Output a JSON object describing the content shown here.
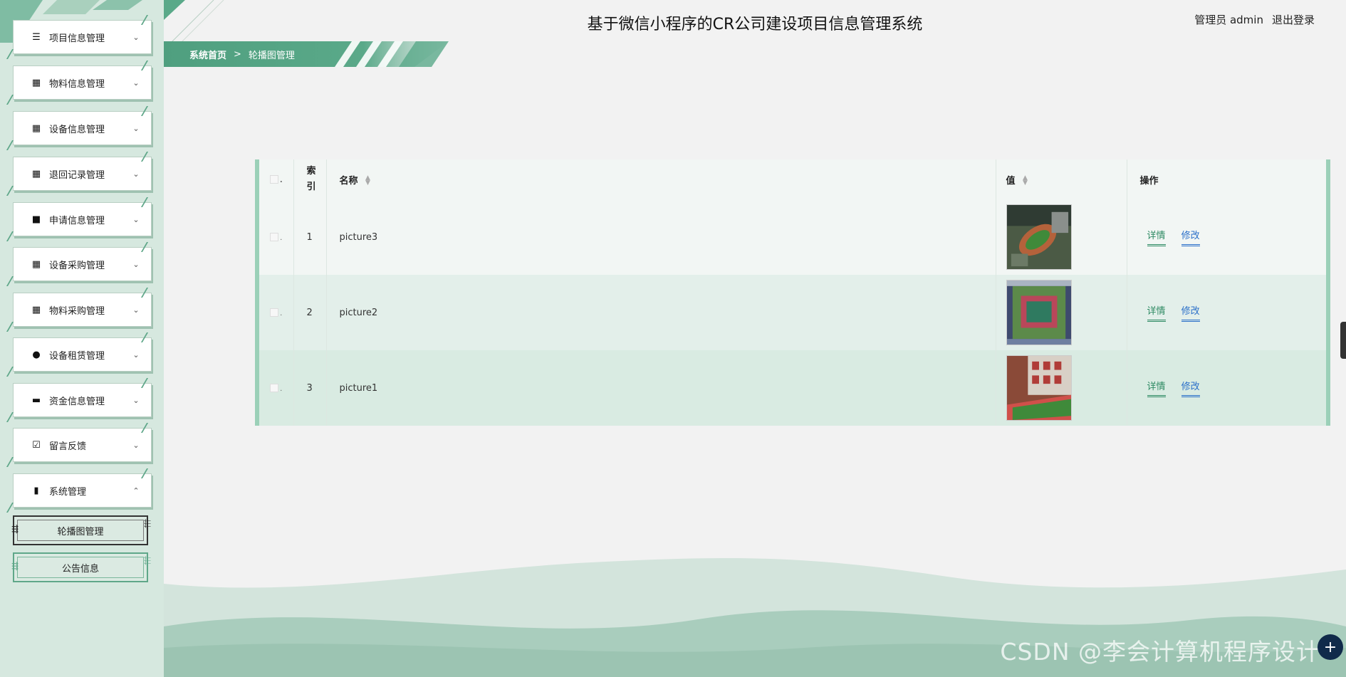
{
  "header": {
    "title": "基于微信小程序的CR公司建设项目信息管理系统",
    "user_label": "管理员 admin",
    "logout_label": "退出登录"
  },
  "breadcrumb": {
    "home": "系统首页",
    "separator": ">",
    "current": "轮播图管理"
  },
  "sidebar": {
    "items": [
      {
        "label": "项目信息管理",
        "icon": "list-icon"
      },
      {
        "label": "物料信息管理",
        "icon": "grid-icon"
      },
      {
        "label": "设备信息管理",
        "icon": "grid-icon"
      },
      {
        "label": "退回记录管理",
        "icon": "grid-icon"
      },
      {
        "label": "申请信息管理",
        "icon": "briefcase-icon"
      },
      {
        "label": "设备采购管理",
        "icon": "grid-icon"
      },
      {
        "label": "物料采购管理",
        "icon": "grid-icon"
      },
      {
        "label": "设备租赁管理",
        "icon": "pin-icon"
      },
      {
        "label": "资金信息管理",
        "icon": "ticket-icon"
      },
      {
        "label": "留言反馈",
        "icon": "clipboard-icon"
      },
      {
        "label": "系统管理",
        "icon": "book-icon"
      }
    ],
    "sub_items": [
      "轮播图管理",
      "公告信息"
    ]
  },
  "table": {
    "columns": {
      "index": "索引",
      "name": "名称",
      "value": "值",
      "ops": "操作"
    },
    "rows": [
      {
        "index": "1",
        "name": "picture3"
      },
      {
        "index": "2",
        "name": "picture2"
      },
      {
        "index": "3",
        "name": "picture1"
      }
    ],
    "detail_label": "详情",
    "edit_label": "修改"
  },
  "watermark": "CSDN @李会计算机程序设计",
  "colors": {
    "brand_green": "#4f9f7f",
    "link_blue": "#2a6fc9",
    "sidebar_bg": "#d6e8df"
  }
}
